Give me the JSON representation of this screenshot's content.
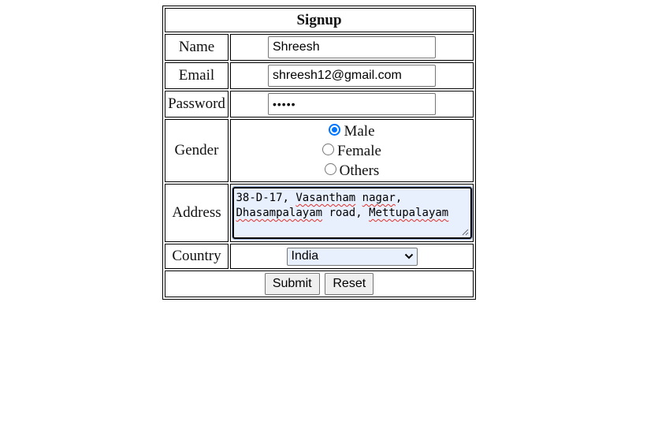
{
  "form": {
    "title": "Signup",
    "name": {
      "label": "Name",
      "value": "Shreesh"
    },
    "email": {
      "label": "Email",
      "value": "shreesh12@gmail.com"
    },
    "password": {
      "label": "Password",
      "value": "•••••"
    },
    "gender": {
      "label": "Gender",
      "options": [
        "Male",
        "Female",
        "Others"
      ],
      "selected": "Male"
    },
    "address": {
      "label": "Address",
      "line1_a": "38-D-17, ",
      "line1_b": "Vasantham",
      "line1_c": " ",
      "line1_d": "nagar",
      "line1_e": ",",
      "line2_a": "Dhasampalayam",
      "line2_b": " road, ",
      "line2_c": "Mettupalayam"
    },
    "country": {
      "label": "Country",
      "value": "India"
    },
    "buttons": {
      "submit": "Submit",
      "reset": "Reset"
    }
  },
  "colors": {
    "radio_checked": "#0075ff",
    "autofill_background": "#e8f0fe",
    "spellcheck_underline": "#e0302b"
  }
}
